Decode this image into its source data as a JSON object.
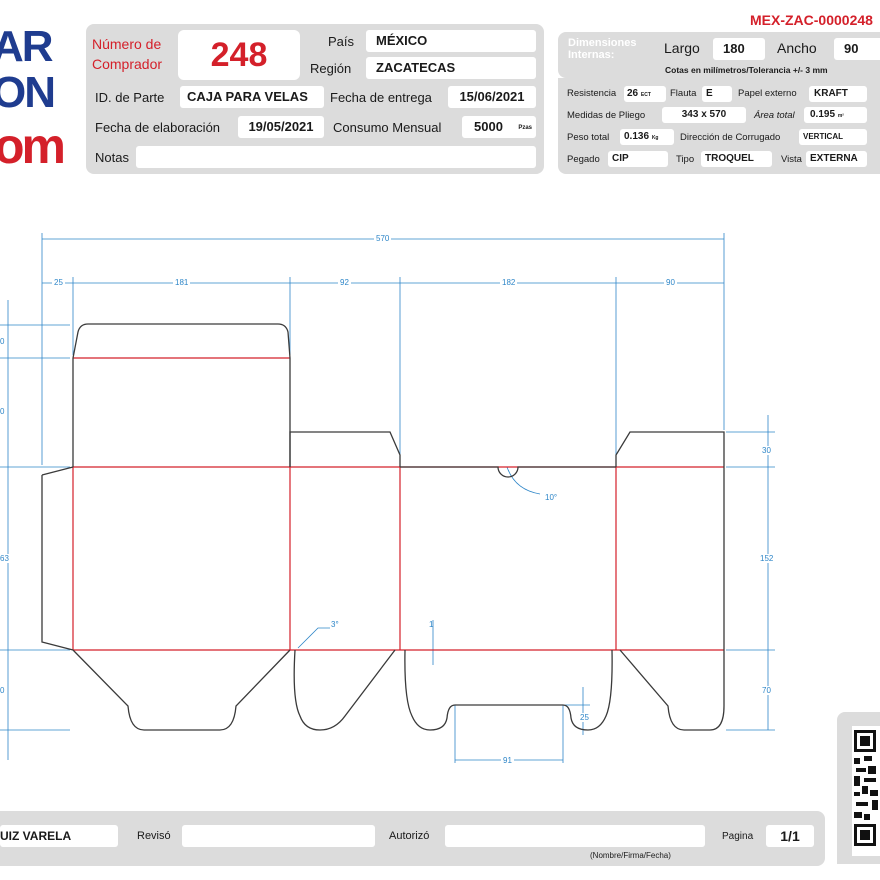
{
  "header": {
    "code": "MEX-ZAC-0000248",
    "buyer_label_line1": "Número de",
    "buyer_label_line2": "Comprador",
    "buyer_number": "248",
    "country_label": "País",
    "country_value": "MÉXICO",
    "region_label": "Región",
    "region_value": "ZACATECAS",
    "part_label": "ID. de Parte",
    "part_value": "CAJA PARA VELAS",
    "delivery_label": "Fecha de entrega",
    "delivery_value": "15/06/2021",
    "made_label": "Fecha de elaboración",
    "made_value": "19/05/2021",
    "consumption_label": "Consumo Mensual",
    "consumption_value": "5000",
    "consumption_unit": "Pzas",
    "notes_label": "Notas",
    "notes_value": ""
  },
  "logo": {
    "line1": "AR",
    "line2": "ON",
    "line3": "om"
  },
  "dimensions": {
    "title_line1": "Dimensiones",
    "title_line2": "Internas:",
    "largo_label": "Largo",
    "largo_value": "180",
    "ancho_label": "Ancho",
    "ancho_value": "90",
    "note": "Cotas en milímetros/Tolerancia +/- 3 mm"
  },
  "specs": {
    "resistencia_label": "Resistencia",
    "resistencia_value": "26",
    "resistencia_unit": "ECT",
    "flauta_label": "Flauta",
    "flauta_value": "E",
    "papel_label": "Papel externo",
    "papel_value": "KRAFT",
    "medidas_label": "Medidas de Pliego",
    "medidas_value": "343 x 570",
    "area_label": "Área total",
    "area_value": "0.195",
    "area_unit": "m²",
    "peso_label": "Peso total",
    "peso_value": "0.136",
    "peso_unit": "Kg",
    "corrugado_label": "Dirección de Corrugado",
    "corrugado_value": "VERTICAL",
    "pegado_label": "Pegado",
    "pegado_value": "CIP",
    "tipo_label": "Tipo",
    "tipo_value": "TROQUEL",
    "vista_label": "Vista",
    "vista_value": "EXTERNA"
  },
  "drawing": {
    "dim_total": "570",
    "dim_25": "25",
    "dim_181": "181",
    "dim_92": "92",
    "dim_182": "182",
    "dim_90": "90",
    "dim_30": "30",
    "dim_152": "152",
    "dim_70": "70",
    "dim_25b": "25",
    "dim_91": "91",
    "dim_1": "1",
    "dim_10deg": "10°",
    "dim_3deg": "3°",
    "left_0a": "0",
    "left_0b": "0",
    "left_63": "63",
    "left_0c": "0",
    "colors": {
      "cut": "#3a3a3a",
      "crease": "#d4202a",
      "dimension": "#2e86c8"
    }
  },
  "footer": {
    "elaboro_value": "UIZ VARELA",
    "reviso_label": "Revisó",
    "reviso_value": "",
    "autorizo_label": "Autorizó",
    "autorizo_value": "",
    "firma_note": "(Nombre/Firma/Fecha)",
    "pagina_label": "Pagina",
    "pagina_value": "1/1"
  },
  "qr": {
    "icon": "qr-code-icon"
  }
}
